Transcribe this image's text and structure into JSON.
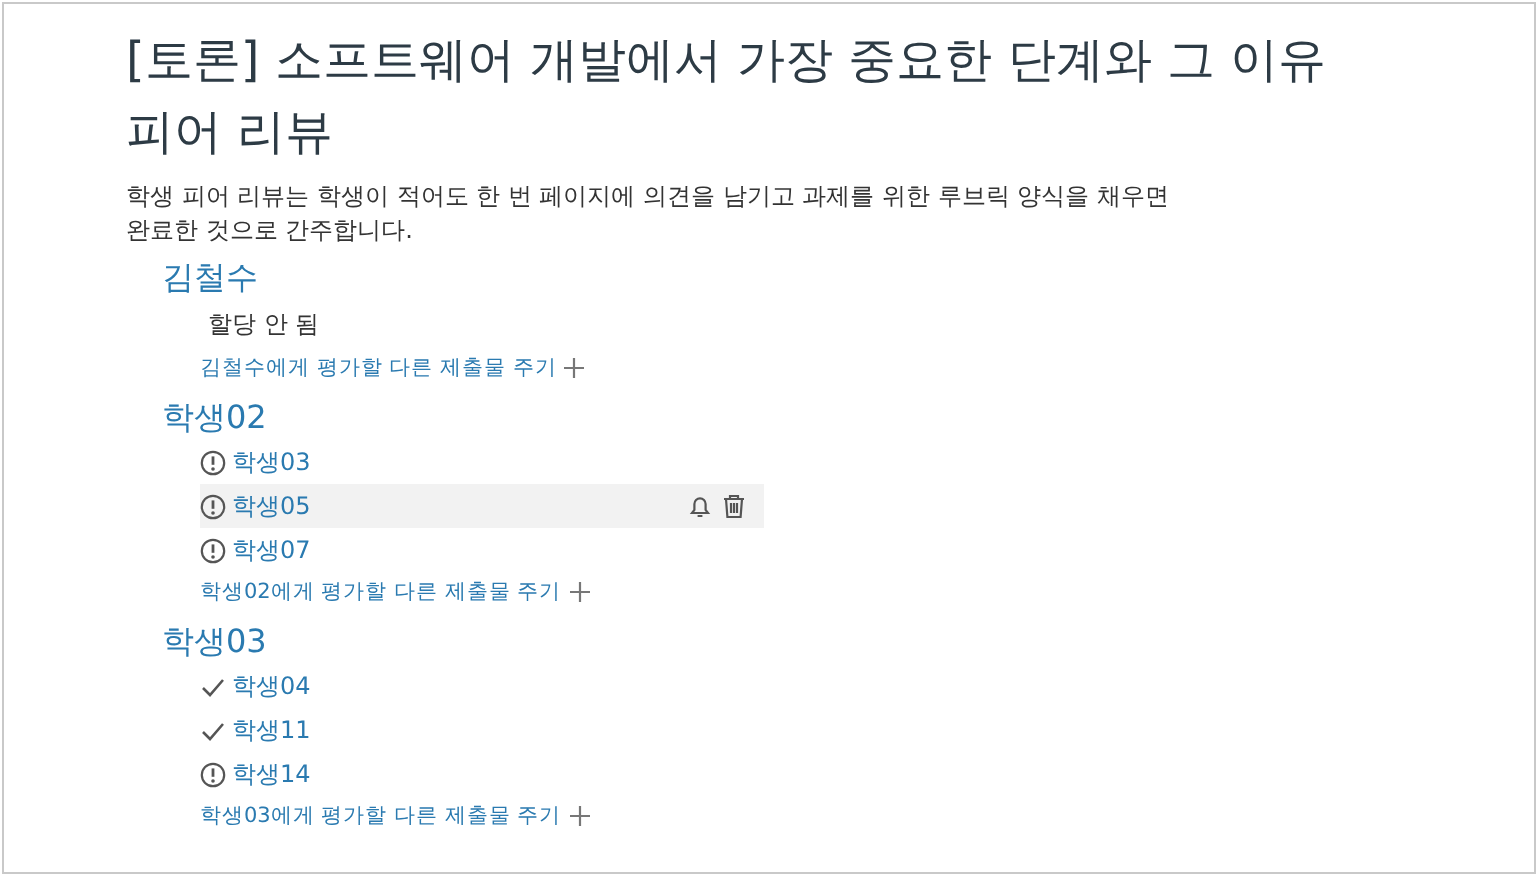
{
  "title": "[토론] 소프트웨어 개발에서 가장 중요한 단계와 그 이유 피어 리뷰",
  "description": "학생 피어 리뷰는 학생이 적어도 한 번 페이지에 의견을 남기고 과제를 위한 루브릭 양식을 채우면 완료한 것으로 간주합니다.",
  "reviewers": [
    {
      "name": "김철수",
      "empty_note": "할당 안 됨",
      "add_link": "김철수에게 평가할 다른 제출물 주기"
    },
    {
      "name": "학생02",
      "assessments": [
        {
          "name": "학생03",
          "kind": "pending",
          "highlighted": false
        },
        {
          "name": "학생05",
          "kind": "pending",
          "highlighted": true
        },
        {
          "name": "학생07",
          "kind": "pending",
          "highlighted": false
        }
      ],
      "add_link": "학생02에게 평가할 다른 제출물 주기"
    },
    {
      "name": "학생03",
      "assessments": [
        {
          "name": "학생04",
          "kind": "done",
          "highlighted": false
        },
        {
          "name": "학생11",
          "kind": "done",
          "highlighted": false
        },
        {
          "name": "학생14",
          "kind": "pending",
          "highlighted": false
        }
      ],
      "add_link": "학생03에게 평가할 다른 제출물 주기"
    }
  ]
}
